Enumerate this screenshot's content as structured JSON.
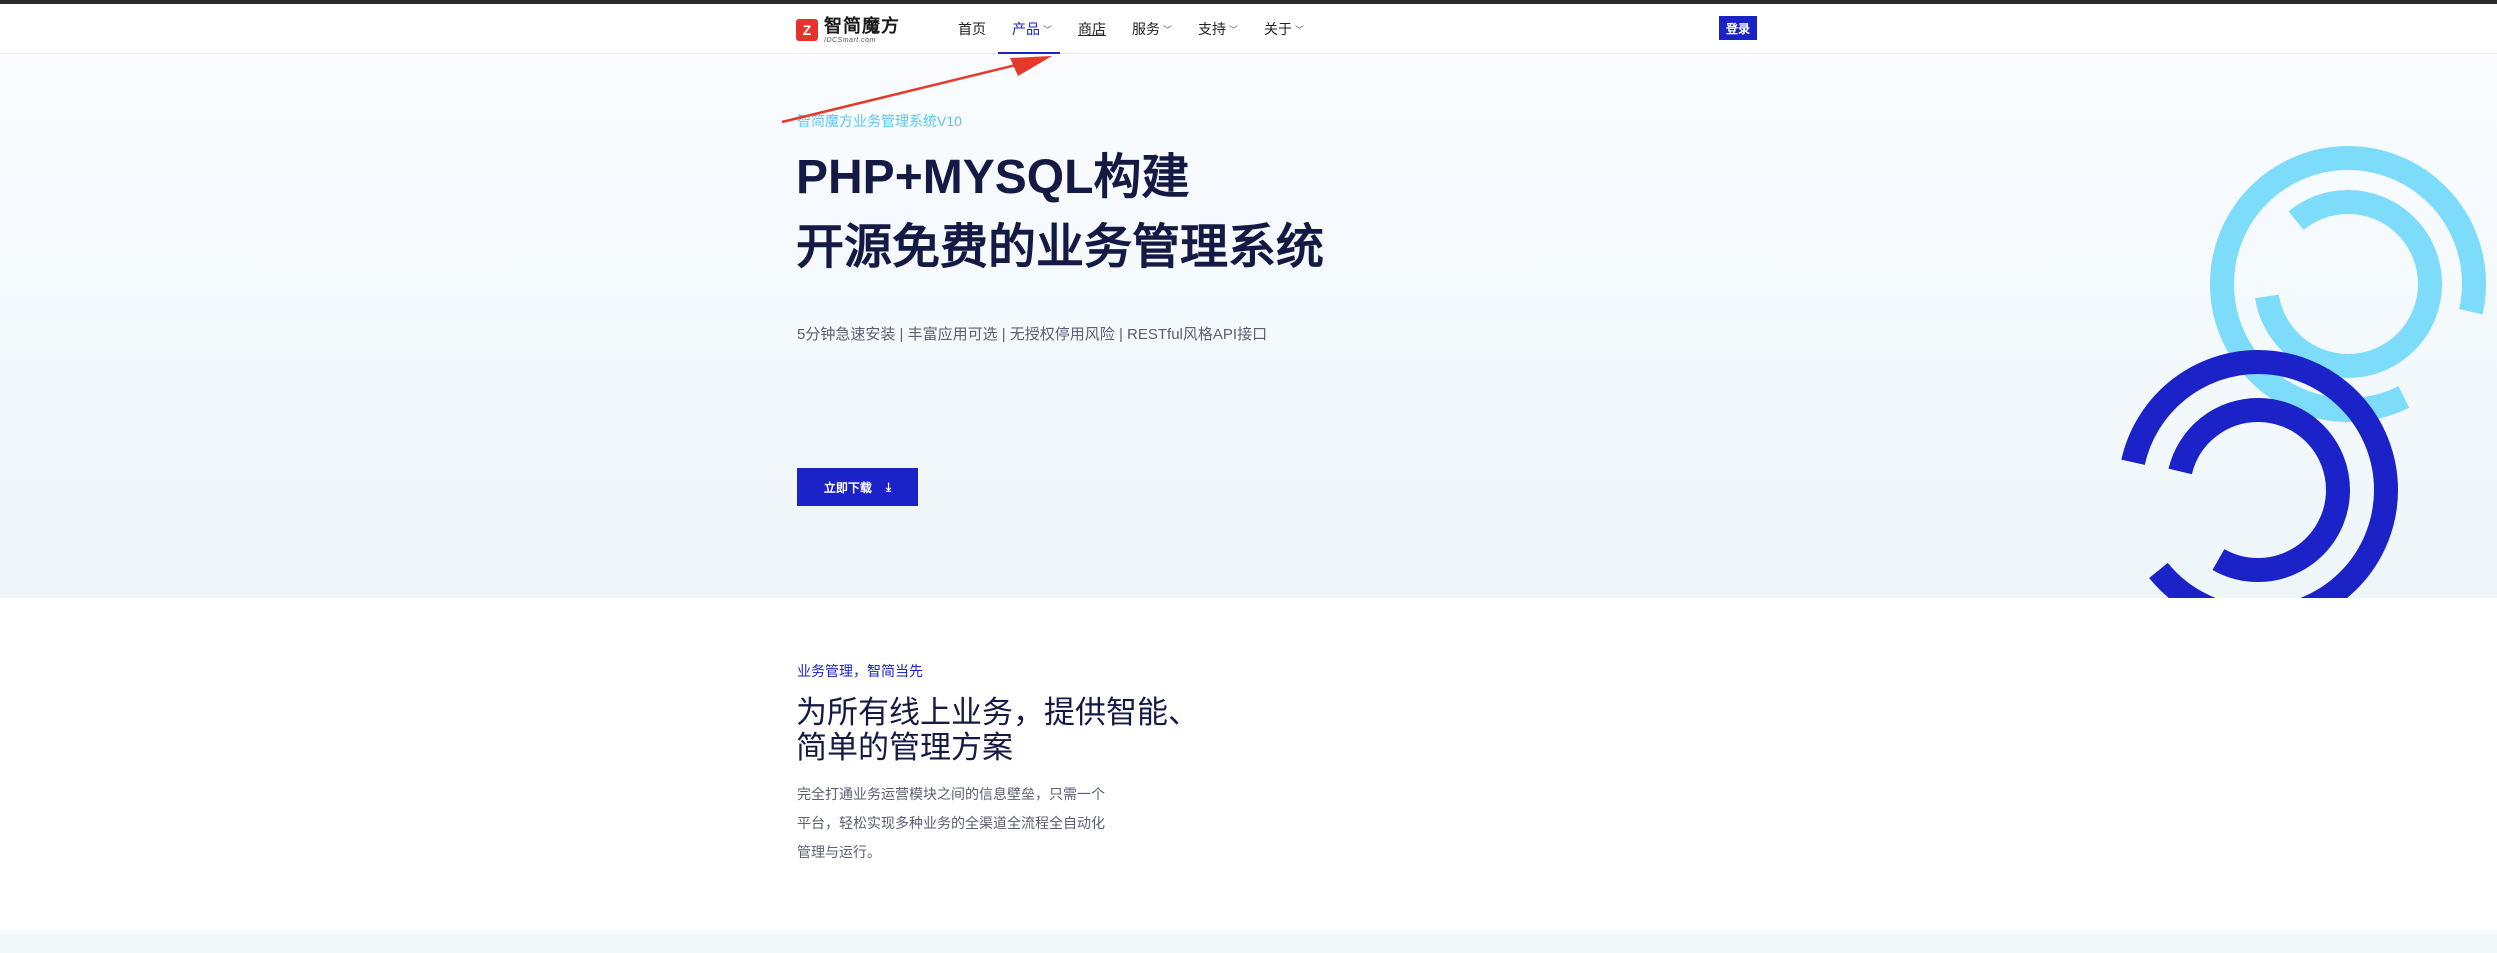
{
  "header": {
    "logo_name": "智简魔方",
    "logo_sub": "IDCSmart.com",
    "nav": [
      {
        "label": "首页",
        "has_dropdown": false
      },
      {
        "label": "产品",
        "has_dropdown": true,
        "active": true
      },
      {
        "label": "商店",
        "has_dropdown": false
      },
      {
        "label": "服务",
        "has_dropdown": true
      },
      {
        "label": "支持",
        "has_dropdown": true
      },
      {
        "label": "关于",
        "has_dropdown": true
      }
    ],
    "login_label": "登录"
  },
  "hero": {
    "eyebrow": "智简魔方业务管理系统V10",
    "title_line1": "PHP+MYSQL构建",
    "title_line2": "开源免费的业务管理系统",
    "features": "5分钟急速安装 | 丰富应用可选 | 无授权停用风险 | RESTful风格API接口",
    "download_label": "立即下载",
    "download_icon": "download-icon"
  },
  "section2": {
    "eyebrow": "业务管理，智简当先",
    "title_line1": "为所有线上业务，提供智能、",
    "title_line2": "简单的管理方案",
    "desc_line1": "完全打通业务运营模块之间的信息壁垒，只需一个",
    "desc_line2": "平台，轻松实现多种业务的全渠道全流程全自动化",
    "desc_line3": "管理与运行。"
  },
  "colors": {
    "brand_blue": "#1a22c8",
    "light_blue": "#7edcfb",
    "annotation_red": "#e53a2b"
  }
}
